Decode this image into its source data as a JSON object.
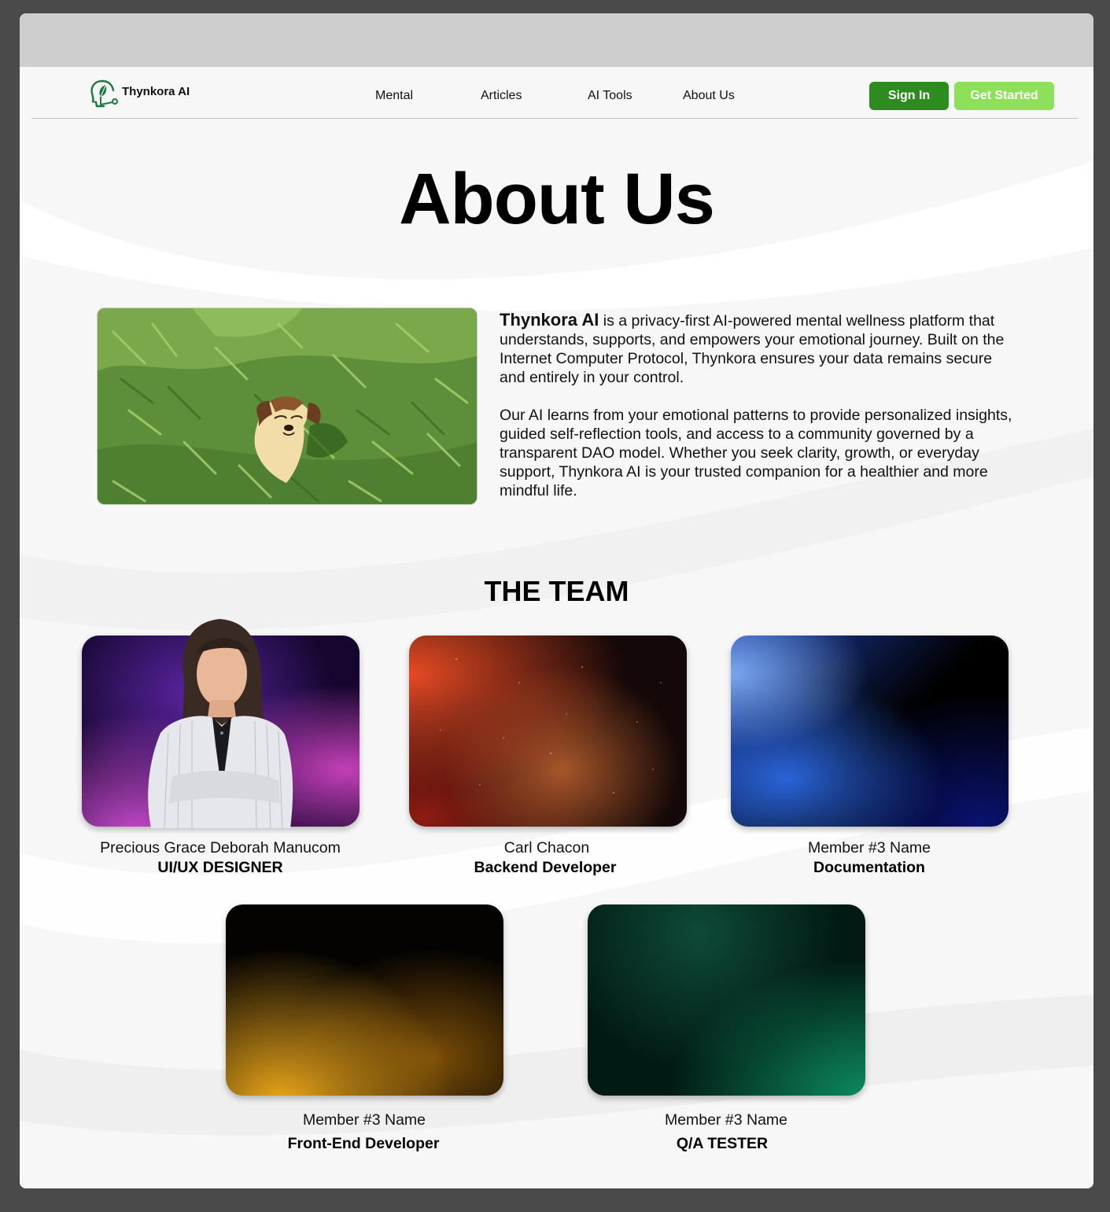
{
  "brand": {
    "name": "Thynkora AI",
    "accent": "#2e8b1f",
    "accent_light": "#8ee05a"
  },
  "nav": {
    "items": [
      {
        "label": "Mental"
      },
      {
        "label": "Articles"
      },
      {
        "label": "AI Tools"
      },
      {
        "label": "About Us"
      }
    ],
    "sign_in": "Sign In",
    "get_started": "Get Started"
  },
  "page": {
    "title": "About Us"
  },
  "intro": {
    "brand": "Thynkora AI",
    "paragraph1_rest": " is a privacy-first AI-powered mental wellness platform that understands, supports, and empowers your emotional journey. Built on the Internet Computer Protocol, Thynkora ensures your data remains secure and entirely in your control.",
    "paragraph2": "Our AI learns from your emotional patterns to provide personalized insights, guided self-reflection tools, and access to a community governed by a transparent DAO model. Whether you seek clarity, growth, or everyday support, Thynkora AI is your trusted companion for a healthier and more mindful life."
  },
  "team": {
    "title": "THE TEAM",
    "members": [
      {
        "name": "Precious Grace Deborah Manucom",
        "role": "UI/UX DESIGNER"
      },
      {
        "name": "Carl Chacon",
        "role": "Backend Developer"
      },
      {
        "name": "Member #3 Name",
        "role": "Documentation"
      },
      {
        "name": "Member #3 Name",
        "role": "Front-End Developer"
      },
      {
        "name": "Member #3 Name",
        "role": "Q/A TESTER"
      }
    ]
  }
}
